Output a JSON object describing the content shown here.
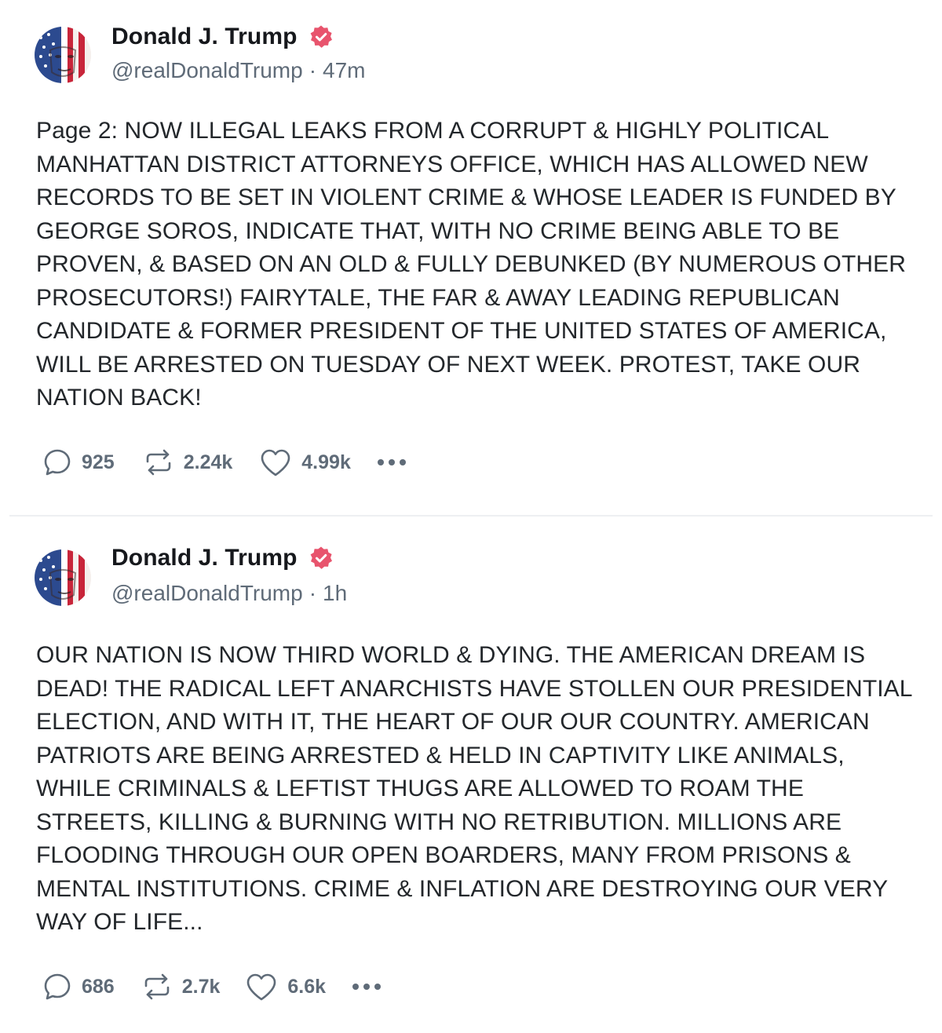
{
  "colors": {
    "verified_badge": "#e8546d",
    "text": "#23272b",
    "meta": "#5f6b78",
    "divider": "#eef0f2"
  },
  "posts": [
    {
      "author": {
        "display_name": "Donald J. Trump",
        "handle": "@realDonaldTrump",
        "verified_icon": "verified-badge-icon",
        "avatar": "flag-painted-face-avatar"
      },
      "separator": "·",
      "time": "47m",
      "text": "Page 2: NOW ILLEGAL LEAKS FROM A CORRUPT & HIGHLY POLITICAL MANHATTAN DISTRICT ATTORNEYS OFFICE, WHICH HAS ALLOWED NEW RECORDS TO BE SET IN VIOLENT CRIME & WHOSE LEADER IS FUNDED BY GEORGE SOROS, INDICATE THAT, WITH NO CRIME BEING ABLE TO BE PROVEN, & BASED ON AN OLD & FULLY DEBUNKED (BY NUMEROUS OTHER PROSECUTORS!) FAIRYTALE, THE FAR & AWAY LEADING REPUBLICAN CANDIDATE & FORMER PRESIDENT OF THE UNITED STATES OF AMERICA, WILL BE ARRESTED ON TUESDAY OF NEXT WEEK. PROTEST, TAKE OUR NATION BACK!",
      "stats": {
        "replies": "925",
        "reposts": "2.24k",
        "likes": "4.99k"
      }
    },
    {
      "author": {
        "display_name": "Donald J. Trump",
        "handle": "@realDonaldTrump",
        "verified_icon": "verified-badge-icon",
        "avatar": "flag-painted-face-avatar"
      },
      "separator": "·",
      "time": "1h",
      "text": "OUR NATION IS NOW THIRD WORLD & DYING. THE AMERICAN DREAM IS DEAD! THE RADICAL LEFT ANARCHISTS HAVE STOLLEN  OUR PRESIDENTIAL ELECTION, AND WITH IT, THE HEART OF OUR OUR COUNTRY. AMERICAN PATRIOTS ARE BEING ARRESTED & HELD IN CAPTIVITY LIKE ANIMALS, WHILE CRIMINALS & LEFTIST THUGS ARE ALLOWED TO ROAM THE STREETS, KILLING & BURNING WITH NO RETRIBUTION. MILLIONS ARE FLOODING THROUGH OUR OPEN BOARDERS, MANY FROM PRISONS & MENTAL INSTITUTIONS. CRIME & INFLATION ARE DESTROYING OUR VERY WAY OF LIFE...",
      "stats": {
        "replies": "686",
        "reposts": "2.7k",
        "likes": "6.6k"
      }
    }
  ]
}
